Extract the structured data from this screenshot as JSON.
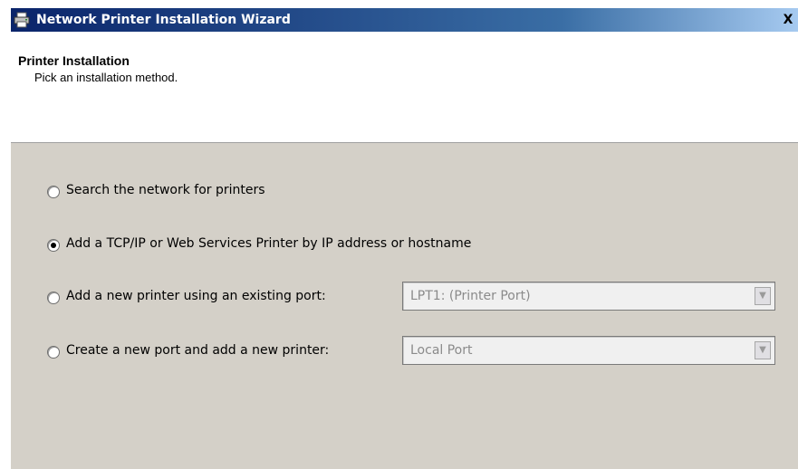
{
  "window": {
    "title": "Network Printer Installation Wizard",
    "close_label": "X"
  },
  "header": {
    "title": "Printer Installation",
    "subtitle": "Pick an installation method."
  },
  "options": [
    {
      "label": "Search the network for printers",
      "checked": false
    },
    {
      "label": "Add a TCP/IP or Web Services Printer by IP address or hostname",
      "checked": true
    },
    {
      "label": "Add a new printer using an existing port:",
      "checked": false
    },
    {
      "label": "Create a new port and add a new printer:",
      "checked": false
    }
  ],
  "existing_port_select": {
    "value": "LPT1: (Printer Port)",
    "disabled": true
  },
  "new_port_select": {
    "value": "Local Port",
    "disabled": true
  },
  "icons": {
    "title_icon": "printer-icon",
    "dropdown_arrow": "chevron-down-icon"
  },
  "colors": {
    "titlebar_start": "#0a246a",
    "dialog_background": "#d4d0c8"
  }
}
